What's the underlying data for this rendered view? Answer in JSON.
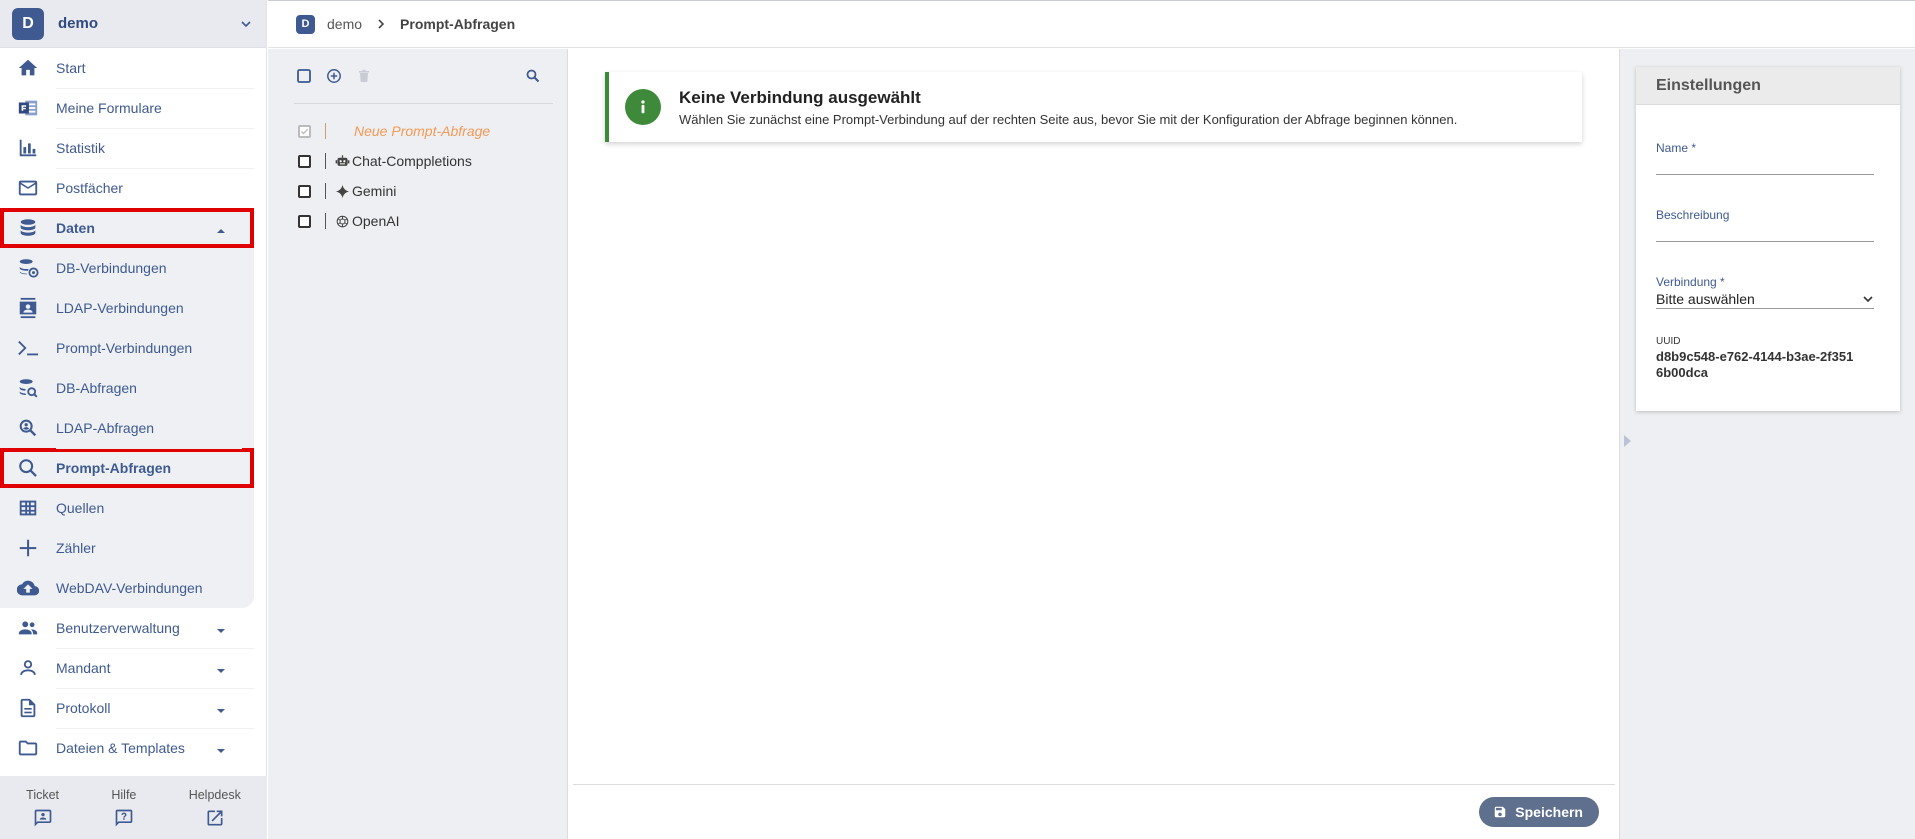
{
  "tenant": {
    "initial": "D",
    "name": "demo"
  },
  "sidebar": {
    "items": [
      {
        "label": "Start",
        "icon": "home-icon"
      },
      {
        "label": "Meine Formulare",
        "icon": "forms-icon"
      },
      {
        "label": "Statistik",
        "icon": "bar-chart-icon"
      },
      {
        "label": "Postfächer",
        "icon": "mail-icon"
      }
    ],
    "group": {
      "label": "Daten",
      "icon": "database-icon",
      "highlighted": true,
      "children": [
        {
          "label": "DB-Verbindungen",
          "icon": "db-settings-icon"
        },
        {
          "label": "LDAP-Verbindungen",
          "icon": "contact-card-icon"
        },
        {
          "label": "Prompt-Verbindungen",
          "icon": "terminal-icon"
        },
        {
          "label": "DB-Abfragen",
          "icon": "db-search-icon"
        },
        {
          "label": "LDAP-Abfragen",
          "icon": "person-search-icon"
        },
        {
          "label": "Prompt-Abfragen",
          "icon": "search-icon",
          "active": true,
          "highlighted": true
        },
        {
          "label": "Quellen",
          "icon": "table-icon"
        },
        {
          "label": "Zähler",
          "icon": "plus-icon"
        },
        {
          "label": "WebDAV-Verbindungen",
          "icon": "cloud-upload-icon"
        }
      ]
    },
    "bottom_items": [
      {
        "label": "Benutzerverwaltung",
        "icon": "people-icon"
      },
      {
        "label": "Mandant",
        "icon": "person-icon"
      },
      {
        "label": "Protokoll",
        "icon": "document-icon"
      },
      {
        "label": "Dateien & Templates",
        "icon": "folder-icon"
      }
    ],
    "footer": [
      {
        "label": "Ticket",
        "icon": "ticket-icon"
      },
      {
        "label": "Hilfe",
        "icon": "help-icon"
      },
      {
        "label": "Helpdesk",
        "icon": "external-link-icon"
      }
    ]
  },
  "breadcrumb": {
    "initial": "D",
    "root": "demo",
    "current": "Prompt-Abfragen"
  },
  "tree": {
    "new_item": "Neue Prompt-Abfrage",
    "items": [
      {
        "label": "Chat-Comppletions",
        "icon": "robot-icon"
      },
      {
        "label": "Gemini",
        "icon": "sparkle-icon"
      },
      {
        "label": "OpenAI",
        "icon": "openai-icon"
      }
    ]
  },
  "alert": {
    "title": "Keine Verbindung ausgewählt",
    "message": "Wählen Sie zunächst eine Prompt-Verbindung auf der rechten Seite aus, bevor Sie mit der Konfiguration der Abfrage beginnen können.",
    "color": "#3f8a3a"
  },
  "actions": {
    "save_label": "Speichern"
  },
  "settings": {
    "title": "Einstellungen",
    "name_label": "Name *",
    "description_label": "Beschreibung",
    "connection_label": "Verbindung *",
    "connection_value": "Bitte auswählen",
    "uuid_label": "UUID",
    "uuid_value": "d8b9c548-e762-4144-b3ae-2f3516b00dca"
  },
  "colors": {
    "brand": "#3e5a91",
    "highlight": "#e00000",
    "new_item": "#f39a56",
    "save_button": "#5f6f8e"
  }
}
